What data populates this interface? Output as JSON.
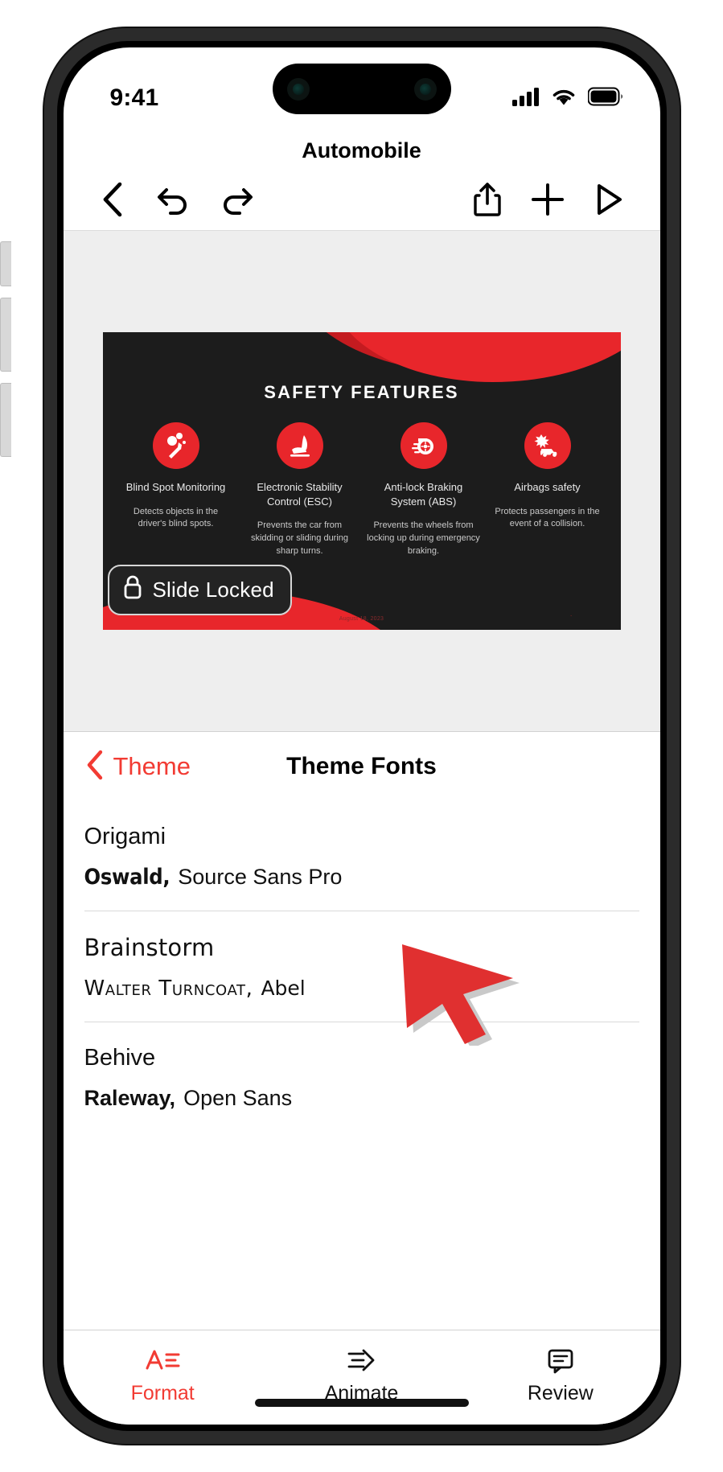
{
  "status_bar": {
    "time": "9:41",
    "cellular_icon": "cellular-bars-icon",
    "wifi_icon": "wifi-icon",
    "battery_icon": "battery-icon"
  },
  "document": {
    "title": "Automobile"
  },
  "toolbar": {
    "back_icon": "chevron-left-icon",
    "undo_icon": "undo-arrow-icon",
    "redo_icon": "redo-arrow-icon",
    "share_icon": "share-upload-icon",
    "add_icon": "plus-icon",
    "play_icon": "play-triangle-icon"
  },
  "slide": {
    "title": "SAFETY FEATURES",
    "date_caption": "August 18, 2023",
    "page_dot": ".",
    "lock_badge": {
      "label": "Slide Locked",
      "icon": "lock-closed-icon"
    },
    "features": [
      {
        "icon": "airbag-person-icon",
        "title": "Blind Spot Monitoring",
        "description": "Detects objects in the driver's blind spots."
      },
      {
        "icon": "car-seat-icon",
        "title": "Electronic Stability Control (ESC)",
        "description": "Prevents the car from skidding or sliding during sharp turns."
      },
      {
        "icon": "brake-disc-icon",
        "title": "Anti-lock Braking System (ABS)",
        "description": "Prevents the wheels from locking up during emergency braking."
      },
      {
        "icon": "car-crash-icon",
        "title": "Airbags safety",
        "description": "Protects passengers in the event of a collision."
      }
    ]
  },
  "panel": {
    "back_label": "Theme",
    "back_icon": "chevron-left-icon",
    "title": "Theme Fonts",
    "fonts": [
      {
        "name": "Origami",
        "heading_font": "Oswald,",
        "body_font": "Source Sans Pro"
      },
      {
        "name": "Brainstorm",
        "heading_font": "Walter Turncoat,",
        "body_font": "Abel"
      },
      {
        "name": "Behive",
        "heading_font": "Raleway,",
        "body_font": "Open Sans"
      }
    ]
  },
  "tabbar": {
    "tabs": [
      {
        "label": "Format",
        "icon": "format-text-icon",
        "active": true
      },
      {
        "label": "Animate",
        "icon": "animate-arrow-icon",
        "active": false
      },
      {
        "label": "Review",
        "icon": "comment-bubble-icon",
        "active": false
      }
    ]
  },
  "colors": {
    "accent_red": "#f23b33",
    "slide_red": "#e8262b",
    "slide_bg": "#1c1c1c",
    "canvas_bg": "#eeeeee"
  },
  "cursor": {
    "icon": "mouse-pointer-arrow",
    "color": "#e03030"
  }
}
